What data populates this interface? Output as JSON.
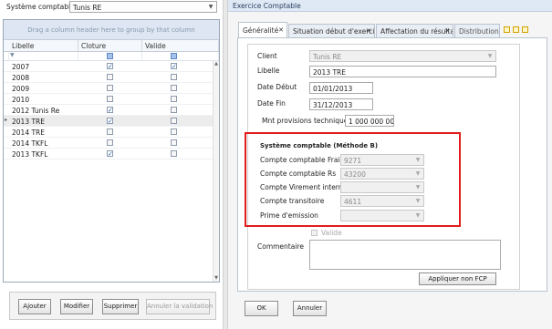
{
  "left": {
    "societe_label": "Système comptable",
    "societe_value": "Tunis RE",
    "group_panel_text": "Drag a column header here to group by that column",
    "columns": [
      "Libelle",
      "Cloture",
      "Valide"
    ],
    "rows": [
      {
        "libelle": "2007",
        "cloture": true,
        "valide": true
      },
      {
        "libelle": "2008",
        "cloture": false,
        "valide": false
      },
      {
        "libelle": "2009",
        "cloture": false,
        "valide": false
      },
      {
        "libelle": "2010",
        "cloture": false,
        "valide": false
      },
      {
        "libelle": "2012 Tunis Re",
        "cloture": true,
        "valide": false
      },
      {
        "libelle": "2013 TRE",
        "cloture": true,
        "valide": false,
        "selected": true
      },
      {
        "libelle": "2014 TRE",
        "cloture": false,
        "valide": false
      },
      {
        "libelle": "2014 TKFL",
        "cloture": false,
        "valide": false
      },
      {
        "libelle": "2013 TKFL",
        "cloture": true,
        "valide": false
      }
    ],
    "buttons": {
      "ajouter": "Ajouter",
      "modifier": "Modifier",
      "supprimer": "Supprimer",
      "annuler_validation": "Annuler la validation"
    }
  },
  "right": {
    "header_title": "Exercice Comptable",
    "tabs": [
      {
        "label": "Généralité",
        "active": true
      },
      {
        "label": "Situation début d'exercice",
        "active": false
      },
      {
        "label": "Affectation du résultat",
        "active": false
      },
      {
        "label": "Distribution de",
        "active": false
      }
    ],
    "form": {
      "client_label": "Client",
      "client_value": "Tunis RE",
      "libelle_label": "Libelle",
      "libelle_value": "2013 TRE",
      "date_debut_label": "Date Début",
      "date_debut_value": "01/01/2013",
      "date_fin_label": "Date Fin",
      "date_fin_value": "31/12/2013",
      "mnt_label": "Mnt provisions techniques",
      "mnt_value": "1 000 000 000,",
      "section_title": "Système comptable (Méthode B)",
      "frais_label": "Compte comptable Frais",
      "frais_value": "9271",
      "rs_label": "Compte comptable Rs",
      "rs_value": "43200",
      "virement_label": "Compte Virement interne",
      "virement_value": "",
      "transitoire_label": "Compte transitoire",
      "transitoire_value": "4611",
      "prime_label": "Prime d'emission",
      "prime_value": "",
      "valide_label": "Valide",
      "commentaire_label": "Commentaire",
      "commentaire_value": "",
      "appliquer_label": "Appliquer non FCP"
    },
    "buttons": {
      "ok": "OK",
      "annuler": "Annuler"
    }
  },
  "colors": {
    "highlight_border": "#e21c1c",
    "checkmark": "#1f5fb4",
    "group_panel_bg": "#dde6f2"
  }
}
